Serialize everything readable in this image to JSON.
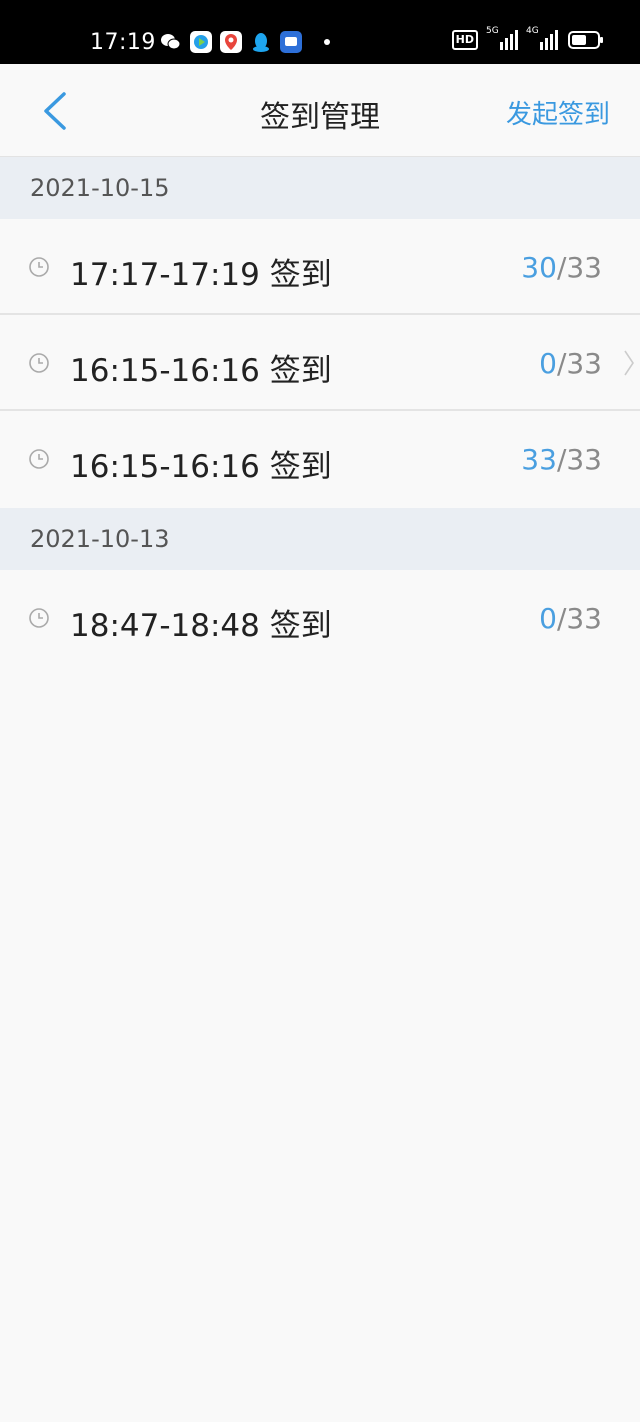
{
  "status_bar": {
    "time": "17:19",
    "hd_label": "HD",
    "signal1_tag": "5G",
    "signal2_tag": "4G"
  },
  "navbar": {
    "title": "签到管理",
    "action_label": "发起签到"
  },
  "groups": [
    {
      "date": "2021-10-15",
      "items": [
        {
          "time_range": "17:17-17:19 签到",
          "signed": "30",
          "total": "/33"
        },
        {
          "time_range": "16:15-16:16 签到",
          "signed": "0",
          "total": "/33"
        },
        {
          "time_range": "16:15-16:16 签到",
          "signed": "33",
          "total": "/33"
        }
      ]
    },
    {
      "date": "2021-10-13",
      "items": [
        {
          "time_range": "18:47-18:48 签到",
          "signed": "0",
          "total": "/33"
        }
      ]
    }
  ],
  "colors": {
    "accent": "#3a99e0",
    "count_signed": "#4a9fe0",
    "section_bg": "#eaeef3"
  }
}
